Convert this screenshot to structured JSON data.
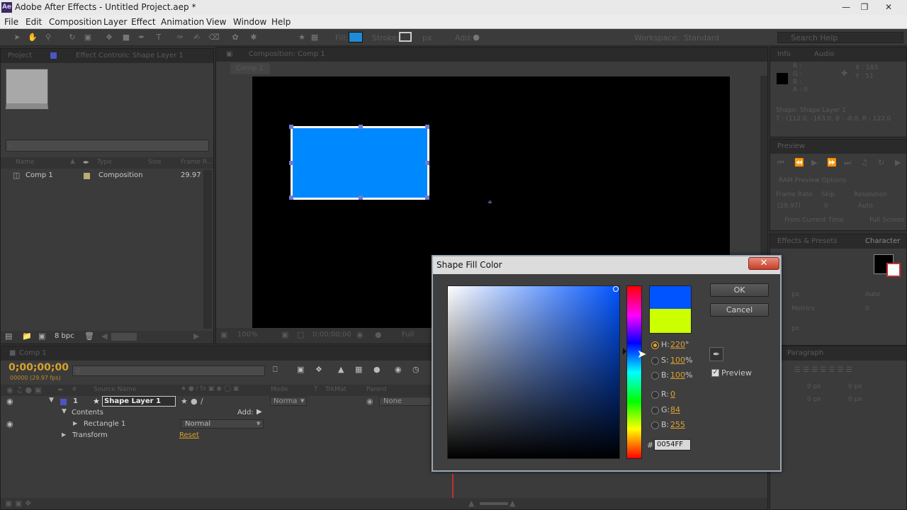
{
  "window": {
    "app_icon": "Ae",
    "title": "Adobe After Effects - Untitled Project.aep *",
    "controls": [
      "minimize-icon",
      "maximize-icon",
      "close-icon"
    ]
  },
  "menu": [
    "File",
    "Edit",
    "Composition",
    "Layer",
    "Effect",
    "Animation",
    "View",
    "Window",
    "Help"
  ],
  "toolbar": {
    "fill_label": "Fill:",
    "stroke_label": "Stroke:",
    "stroke_width": "px",
    "add_label": "Add:",
    "fill_color": "#1f8bd6",
    "workspace_label": "Workspace:",
    "workspace_value": "Standard",
    "search_placeholder": "Search Help"
  },
  "project": {
    "tab": "Project",
    "tab2": "Effect Controls: Shape Layer 1",
    "search_placeholder": "⌕",
    "columns": [
      "Name",
      "Type",
      "Size",
      "Frame R..."
    ],
    "items": [
      {
        "name": "Comp 1",
        "type": "Composition",
        "size": "",
        "frame_rate": "29.97"
      }
    ],
    "bpc": "8 bpc"
  },
  "comp": {
    "tab": "Composition: Comp 1",
    "breadcrumb": "Comp 1",
    "zoom": "100%",
    "timecode": "0;00;00;00",
    "view": "Full",
    "rect_color": "#0088ff"
  },
  "timeline": {
    "tab": "Comp 1",
    "timecode": "0;00;00;00",
    "fps": "00000 (29.97 fps)",
    "columns": {
      "num": "#",
      "source": "Source Name",
      "mode": "Mode",
      "t": "T",
      "trkmat": "TrkMat",
      "parent": "Parent"
    },
    "layer": {
      "index": "1",
      "name": "Shape Layer 1",
      "mode": "Norma",
      "parent": "None"
    },
    "contents": "Contents",
    "add": "Add:",
    "rect": "Rectangle 1",
    "rect_mode": "Normal",
    "transform": "Transform",
    "reset": "Reset"
  },
  "right": {
    "info_tab": "Info",
    "audio_tab": "Audio",
    "info_rgb": [
      "R :",
      "G :",
      "B :",
      "A : 0"
    ],
    "info_xy": [
      "X : 183",
      "Y : 51"
    ],
    "info_shape": "Shape: Shape Layer 1",
    "info_coords": "T : (112.0, -163.0, 8 : -8.0, R : 122.0",
    "preview_tab": "Preview",
    "ram_preview": "RAM Preview Options",
    "frame_rate": "Frame Rate",
    "skip": "Skip",
    "resolution": "Resolution",
    "frame_rate_val": "(29.97)",
    "skip_val": "0",
    "res_val": "Auto",
    "from_current": "From Current Time",
    "full_screen": "Full Screen",
    "effects_tab": "Effects & Presets",
    "character_tab": "Character",
    "paragraph_tab": "Paragraph",
    "px_values": [
      "0 px",
      "0 px",
      "0 px",
      "0 px",
      "0 px"
    ]
  },
  "dialog": {
    "title": "Shape Fill Color",
    "ok": "OK",
    "cancel": "Cancel",
    "new_color": "#0054ff",
    "old_color": "#ccff00",
    "h_label": "H:",
    "h_value": "220",
    "h_unit": "°",
    "s_label": "S:",
    "s_value": "100",
    "s_unit": "%",
    "b_label": "B:",
    "b_value": "100",
    "b_unit": "%",
    "r_label": "R:",
    "r_value": "0",
    "g_label": "G:",
    "g_value": "84",
    "bb_label": "B:",
    "bb_value": "255",
    "hex_label": "#",
    "hex_value": "0054FF",
    "preview": "Preview"
  }
}
